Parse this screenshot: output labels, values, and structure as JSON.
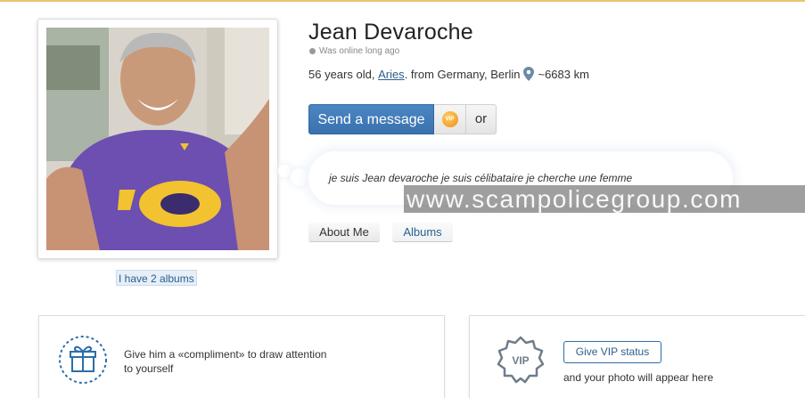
{
  "profile": {
    "name": "Jean Devaroche",
    "online_status": "Was online long ago",
    "age_text": "56 years old,",
    "zodiac": "Aries",
    "location_text": ". from Germany, Berlin",
    "distance": "~6683 km",
    "albums_link": "I have 2 albums"
  },
  "actions": {
    "send_message": "Send a message",
    "vip_coin_label": "VIP",
    "or_label": "or"
  },
  "bio": {
    "text": "je suis Jean devaroche je suis célibataire je cherche une femme"
  },
  "tabs": [
    {
      "label": "About Me"
    },
    {
      "label": "Albums"
    }
  ],
  "watermark": "www.scampolicegroup.com",
  "cards": {
    "compliment": {
      "line1": "Give him a «compliment» to draw attention",
      "line2": "to yourself"
    },
    "vip": {
      "badge_text": "VIP",
      "button": "Give VIP status",
      "caption": "and your photo will appear here"
    }
  },
  "colors": {
    "accent": "#3a71ad",
    "link": "#2b5f8c",
    "shirt": "#6c4fb0",
    "logo_gold": "#f2c230"
  },
  "icons": {
    "location": "map-pin-icon",
    "gift": "gift-icon",
    "vip_badge": "vip-badge-icon",
    "vip_coin": "vip-coin-icon"
  }
}
